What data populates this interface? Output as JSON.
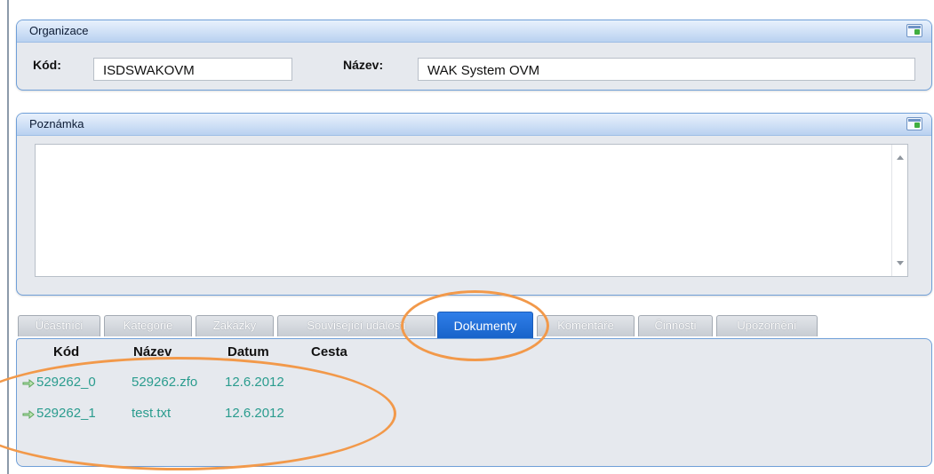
{
  "organization": {
    "title": "Organizace",
    "code_label": "Kód:",
    "code_value": "ISDSWAKOVM",
    "name_label": "Název:",
    "name_value": "WAK System OVM"
  },
  "note": {
    "title": "Poznámka",
    "value": ""
  },
  "tabs": [
    {
      "label": "Účastníci",
      "active": false
    },
    {
      "label": "Kategorie",
      "active": false
    },
    {
      "label": "Zakázky",
      "active": false
    },
    {
      "label": "Související události",
      "active": false
    },
    {
      "label": "Dokumenty",
      "active": true
    },
    {
      "label": "Komentáře",
      "active": false
    },
    {
      "label": "Činnosti",
      "active": false
    },
    {
      "label": "Upozornění",
      "active": false
    }
  ],
  "documents": {
    "columns": [
      "Kód",
      "Název",
      "Datum",
      "Cesta"
    ],
    "rows": [
      {
        "code": "529262_0",
        "name": "529262.zfo",
        "date": "12.6.2012",
        "path": ""
      },
      {
        "code": "529262_1",
        "name": "test.txt",
        "date": "12.6.2012",
        "path": ""
      }
    ]
  },
  "colors": {
    "accent": "#1762c8",
    "link_text": "#2a9c8e",
    "annotation": "#f2994a",
    "panel_border": "#6f9fd8"
  }
}
